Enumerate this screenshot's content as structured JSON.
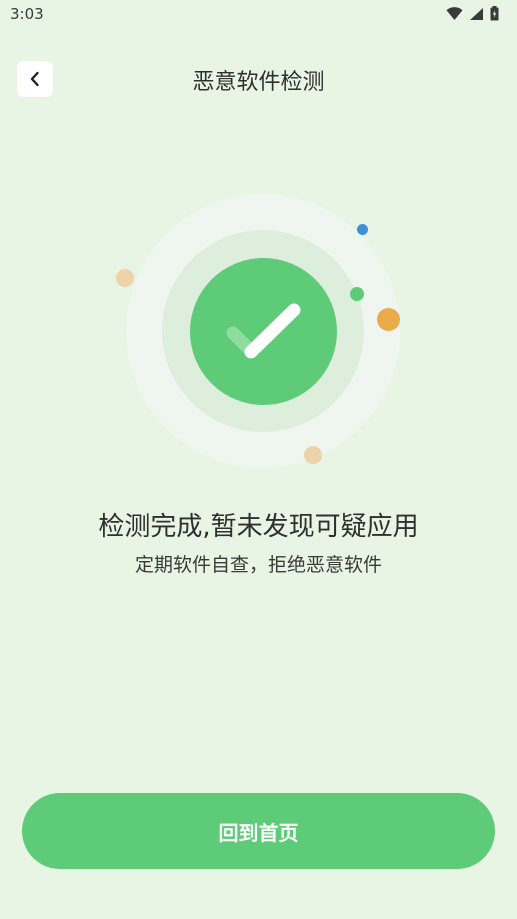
{
  "status_bar": {
    "time": "3:03",
    "icons": [
      "wifi-icon",
      "signal-icon",
      "battery-icon"
    ]
  },
  "header": {
    "back_icon": "chevron-left-icon",
    "title": "恶意软件检测"
  },
  "illustration": {
    "icon": "checkmark-icon",
    "colors": {
      "check_circle": "#5dcb78",
      "ring_middle": "#deeedd",
      "ring_outer": "#eff6ef"
    }
  },
  "result": {
    "title": "检测完成,暂未发现可疑应用",
    "subtitle": "定期软件自查，拒绝恶意软件"
  },
  "actions": {
    "home_button_label": "回到首页"
  },
  "colors": {
    "background": "#e8f5e5",
    "accent": "#5dcb78",
    "text_primary": "#2f2f2f"
  }
}
